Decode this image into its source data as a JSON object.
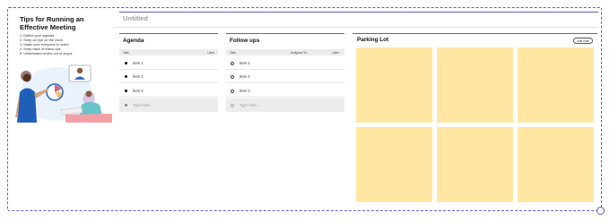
{
  "tips": {
    "title": "Tips for Running an Effective Meeting",
    "items": [
      "1. Define your agenda",
      "2. Keep an eye on the clock",
      "3. Make sure everyone is heard",
      "4. Keep track of follow ups",
      "5. Understand what's out of scope"
    ]
  },
  "page": {
    "title": "Untitled"
  },
  "agenda": {
    "title": "Agenda",
    "columns": [
      "Task",
      "Likes"
    ],
    "items": [
      "Item 1",
      "Item 2",
      "Item 3"
    ],
    "placeholder": "Type here..."
  },
  "followups": {
    "title": "Follow ups",
    "columns": [
      "Task",
      "Assigned To",
      "Likes"
    ],
    "items": [
      "Item 1",
      "Item 2",
      "Item 3"
    ],
    "placeholder": "Type here..."
  },
  "parking": {
    "title": "Parking Lot",
    "add_note_label": "Add note",
    "note_count": 6,
    "note_color": "#ffe7a3"
  },
  "colors": {
    "accent": "#5b5fc7",
    "note": "#ffe7a3"
  }
}
